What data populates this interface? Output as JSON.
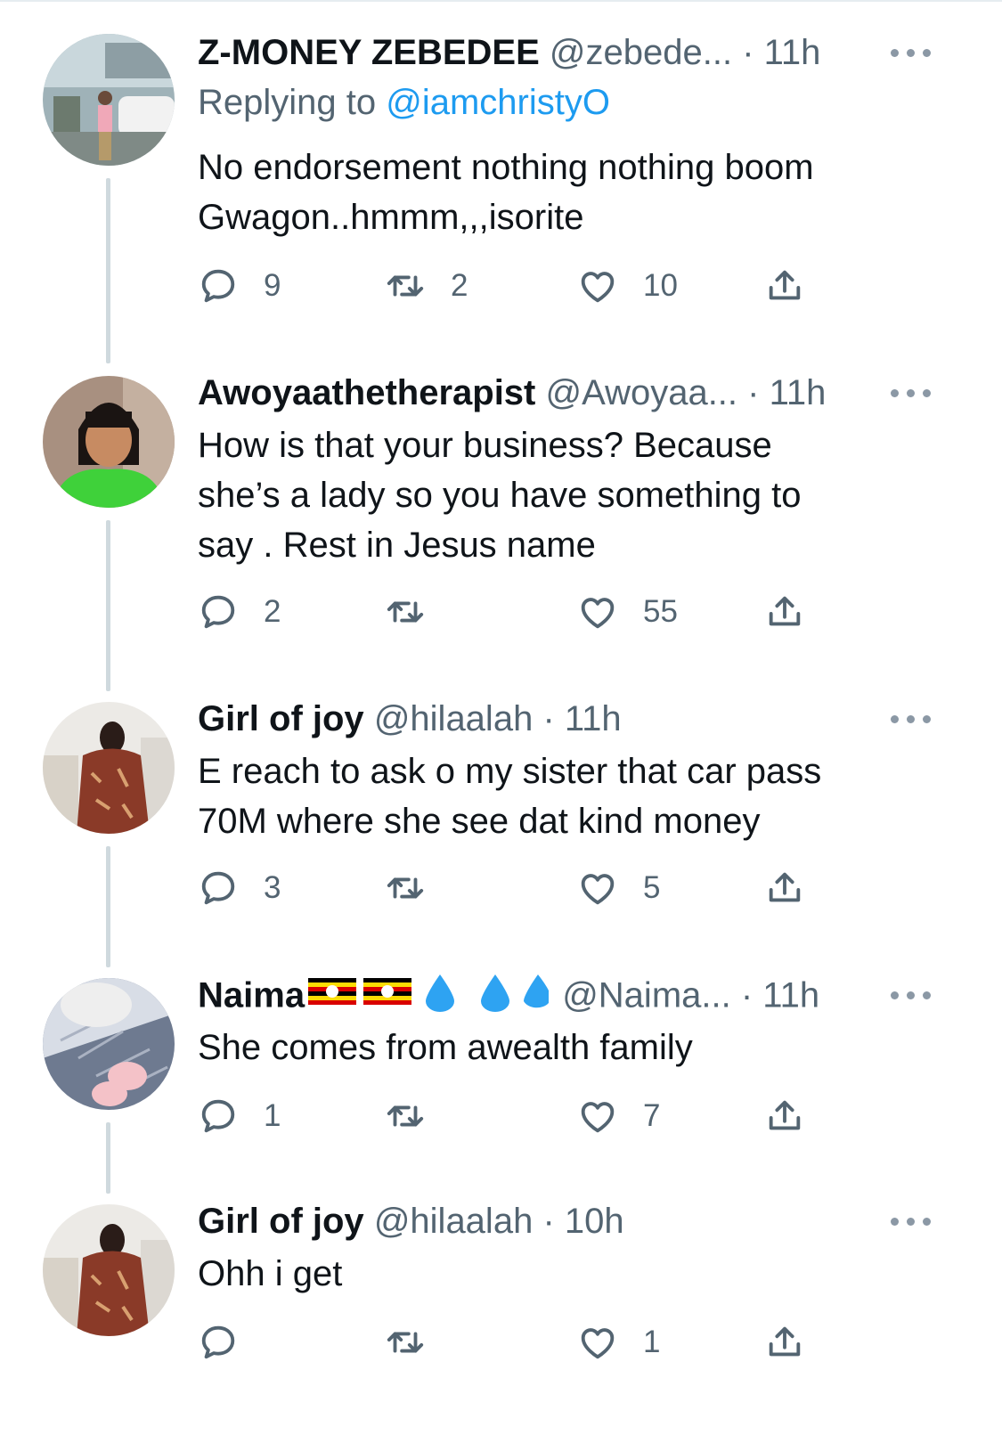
{
  "tweets": [
    {
      "name": "Z-MONEY ZEBEDEE",
      "handle": "@zebede...",
      "time": "11h",
      "replying_prefix": "Replying to",
      "replying_handle": "@iamchristyO",
      "body": [
        "No endorsement nothing nothing boom",
        "Gwagon..hmmm,,,isorite"
      ],
      "replies": "9",
      "retweets": "2",
      "likes": "10"
    },
    {
      "name": "Awoyaathetherapist",
      "handle": "@Awoyaa...",
      "time": "11h",
      "body": [
        "How is that your business? Because",
        "she’s a lady so you have something to",
        "say . Rest in Jesus name"
      ],
      "replies": "2",
      "retweets": "",
      "likes": "55"
    },
    {
      "name": "Girl of joy",
      "handle": "@hilaalah",
      "time": "11h",
      "body": [
        "E reach to ask o my sister that car pass",
        "70M where she see dat kind money"
      ],
      "replies": "3",
      "retweets": "",
      "likes": "5"
    },
    {
      "name": "Naima",
      "name_emoji": [
        "uganda-flag",
        "uganda-flag",
        "droplet",
        "droplet",
        "droplet"
      ],
      "handle": "@Naima...",
      "time": "11h",
      "body": [
        "She comes from awealth family"
      ],
      "replies": "1",
      "retweets": "",
      "likes": "7"
    },
    {
      "name": "Girl of joy",
      "handle": "@hilaalah",
      "time": "10h",
      "body": [
        "Ohh i get"
      ],
      "replies": "",
      "retweets": "",
      "likes": "1"
    }
  ],
  "separator": "·",
  "icons": {
    "reply": "reply-bubble-icon",
    "retweet": "retweet-icon",
    "like": "heart-icon",
    "share": "share-icon",
    "more": "more-options-icon"
  },
  "colors": {
    "text": "#0f1419",
    "secondary": "#536471",
    "link": "#1d9bf0",
    "thread_line": "#cfd9de"
  }
}
